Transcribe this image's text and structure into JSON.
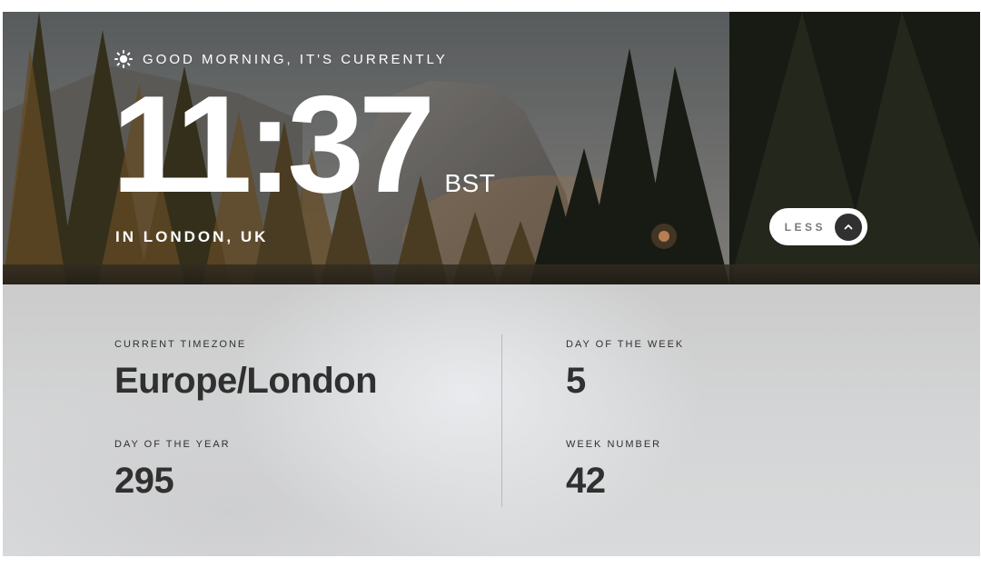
{
  "hero": {
    "greeting": "GOOD MORNING, IT'S CURRENTLY",
    "time": "11:37",
    "timezone_abbreviation": "BST",
    "location": "IN LONDON, UK",
    "toggle_label": "LESS"
  },
  "details": {
    "timezone": {
      "label": "CURRENT TIMEZONE",
      "value": "Europe/London"
    },
    "day_of_year": {
      "label": "DAY OF THE YEAR",
      "value": "295"
    },
    "day_of_week": {
      "label": "DAY OF THE WEEK",
      "value": "5"
    },
    "week_number": {
      "label": "WEEK NUMBER",
      "value": "42"
    }
  },
  "icons": {
    "greeting_icon": "sun-icon",
    "toggle_icon": "chevron-up-icon"
  }
}
